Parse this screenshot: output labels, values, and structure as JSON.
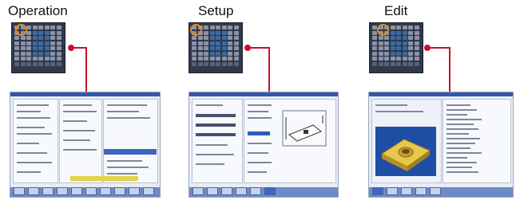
{
  "sections": [
    {
      "title": "Operation",
      "icon": "operation-screen-icon"
    },
    {
      "title": "Setup",
      "icon": "setup-screen-icon"
    },
    {
      "title": "Edit",
      "icon": "edit-screen-icon"
    }
  ],
  "colors": {
    "connector": "#c8102e",
    "highlight_ring": "#e58a1f",
    "screen_blue": "#3457a8",
    "panel_dark": "#30384a"
  }
}
